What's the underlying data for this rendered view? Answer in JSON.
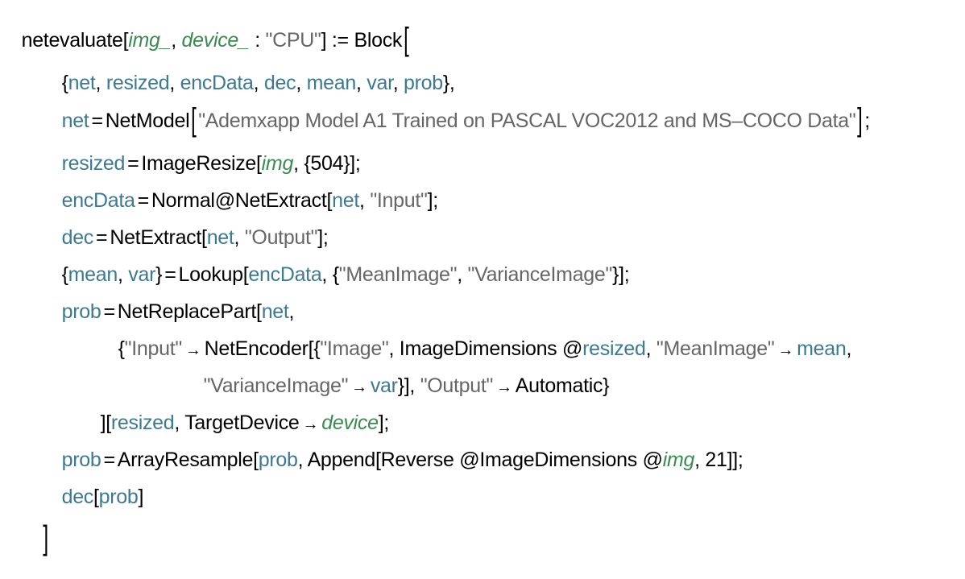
{
  "code": {
    "language": "Wolfram Language",
    "function_name": "netevaluate",
    "param_img": "img_",
    "param_device": "device_",
    "param_sep": " : ",
    "default_device": "\"CPU\"",
    "define_op": "] := ",
    "block": "Block",
    "locals": [
      "net",
      "resized",
      "encData",
      "dec",
      "mean",
      "var",
      "prob"
    ],
    "lines": {
      "net_var": "net",
      "netmodel_fn": "NetModel",
      "model_name": "\"Ademxapp Model A1 Trained on PASCAL VOC2012 and MS–COCO Data\"",
      "resized_var": "resized",
      "imageresize_fn": "ImageResize",
      "img_arg": "img",
      "resize_size": "{504}",
      "encdata_var": "encData",
      "normal_fn": "Normal",
      "netextract_fn": "NetExtract",
      "input_str": "\"Input\"",
      "dec_var": "dec",
      "output_str": "\"Output\"",
      "mean_var": "mean",
      "var_var": "var",
      "lookup_fn": "Lookup",
      "meanimage_str": "\"MeanImage\"",
      "varianceimage_str": "\"VarianceImage\"",
      "prob_var": "prob",
      "netreplacepart_fn": "NetReplacePart",
      "netencoder_fn": "NetEncoder",
      "image_str": "\"Image\"",
      "imagedimensions_fn": "ImageDimensions",
      "automatic_sym": "Automatic",
      "targetdevice_sym": "TargetDevice",
      "device_arg": "device",
      "arrayresample_fn": "ArrayResample",
      "append_fn": "Append",
      "reverse_fn": "Reverse",
      "channels": "21"
    }
  }
}
